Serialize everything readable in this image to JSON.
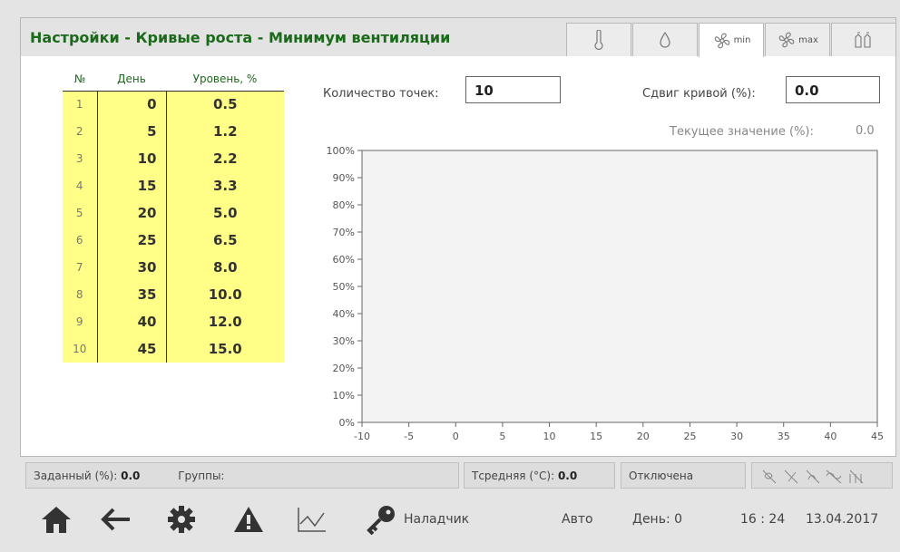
{
  "title": "Настройки - Кривые роста - Минимум вентиляции",
  "tabs": [
    {
      "icon": "thermometer-icon",
      "label": ""
    },
    {
      "icon": "drop-icon",
      "label": ""
    },
    {
      "icon": "fan-icon",
      "label": "min"
    },
    {
      "icon": "fan-icon",
      "label": "max"
    },
    {
      "icon": "silo-icon",
      "label": ""
    }
  ],
  "table": {
    "headers": [
      "№",
      "День",
      "Уровень, %"
    ],
    "rows": [
      {
        "n": "1",
        "day": "0",
        "level": "0.5"
      },
      {
        "n": "2",
        "day": "5",
        "level": "1.2"
      },
      {
        "n": "3",
        "day": "10",
        "level": "2.2"
      },
      {
        "n": "4",
        "day": "15",
        "level": "3.3"
      },
      {
        "n": "5",
        "day": "20",
        "level": "5.0"
      },
      {
        "n": "6",
        "day": "25",
        "level": "6.5"
      },
      {
        "n": "7",
        "day": "30",
        "level": "8.0"
      },
      {
        "n": "8",
        "day": "35",
        "level": "10.0"
      },
      {
        "n": "9",
        "day": "40",
        "level": "12.0"
      },
      {
        "n": "10",
        "day": "45",
        "level": "15.0"
      }
    ]
  },
  "points_label": "Количество точек:",
  "points_value": "10",
  "shift_label": "Сдвиг кривой (%):",
  "shift_value": "0.0",
  "current_label": "Текущее значение (%):",
  "current_value": "0.0",
  "chart_data": {
    "type": "line",
    "x_ticks": [
      "-10",
      "-5",
      "0",
      "5",
      "10",
      "15",
      "20",
      "25",
      "30",
      "35",
      "40",
      "45"
    ],
    "y_ticks": [
      "0%",
      "10%",
      "20%",
      "30%",
      "40%",
      "50%",
      "60%",
      "70%",
      "80%",
      "90%",
      "100%"
    ],
    "xlim": [
      -10,
      45
    ],
    "ylim": [
      0,
      100
    ],
    "series": []
  },
  "status": {
    "setpoint_label": "Заданный (%):",
    "setpoint_value": "0.0",
    "groups_label": "Группы:",
    "tavg_label": "Тсредняя (°C):",
    "tavg_value": "0.0",
    "state": "Отключена"
  },
  "nav": {
    "user": "Наладчик",
    "mode": "Авто",
    "day": "День: 0",
    "time": "16 : 24",
    "date": "13.04.2017"
  },
  "colors": {
    "title": "#1b6a1b",
    "table_bg": "#ffff88",
    "chart_bg": "#f3f3f3"
  }
}
